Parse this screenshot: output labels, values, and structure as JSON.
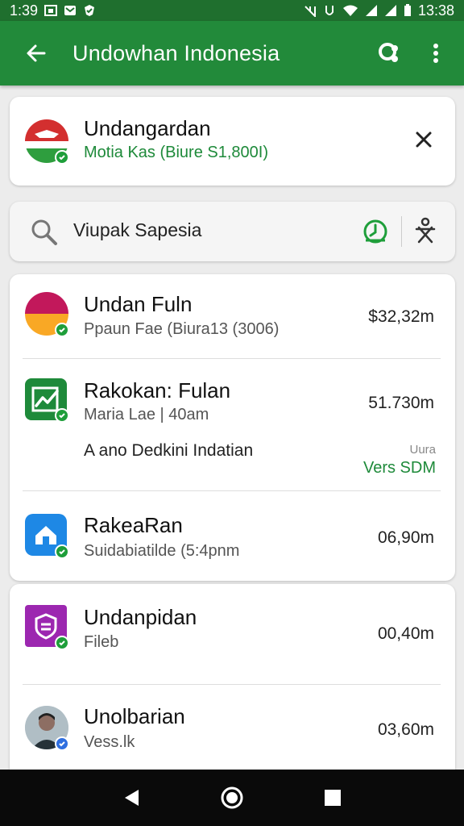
{
  "status_bar": {
    "time_left": "1:39",
    "time_right": "13:38"
  },
  "app_bar": {
    "title": "Undowhan Indonesia",
    "icons": [
      "back-arrow-icon",
      "share-icon",
      "more-vert-icon"
    ]
  },
  "header_card": {
    "name": "Undangardan",
    "subtitle": "Motia Kas (Biure S1,800I)",
    "flag_colors": [
      "#d32f2f",
      "#ffffff",
      "#2e9e3e"
    ]
  },
  "search": {
    "value": "Viupak Sapesia"
  },
  "list": [
    {
      "name": "Undan Fuln",
      "subtitle": "Ppaun Fae  (Biura13 (3006)",
      "amount": "$32,32m",
      "icon": "sunset-avatar"
    },
    {
      "name": "Rakokan: Fulan",
      "subtitle": "Maria Lae | 40am",
      "amount": "51.730m",
      "icon": "chart-icon",
      "extra_line": "A ano Dedkini Indatian",
      "extra_label": "Uura",
      "extra_value": "Vers SDM"
    },
    {
      "name": "RakeaRan",
      "subtitle": "Suidabiatilde (5:4pnm",
      "amount": "06,90m",
      "icon": "home-icon"
    },
    {
      "name": "Undanpidan",
      "subtitle": "Fileb",
      "amount": "00,40m",
      "icon": "shield-icon"
    },
    {
      "name": "Unolbarian",
      "subtitle": "Vess.lk",
      "amount": "03,60m",
      "icon": "person-avatar"
    }
  ],
  "colors": {
    "app_bar": "#228a3a",
    "status_bar": "#1f6f2e",
    "accent_green": "#1e8a3a"
  }
}
